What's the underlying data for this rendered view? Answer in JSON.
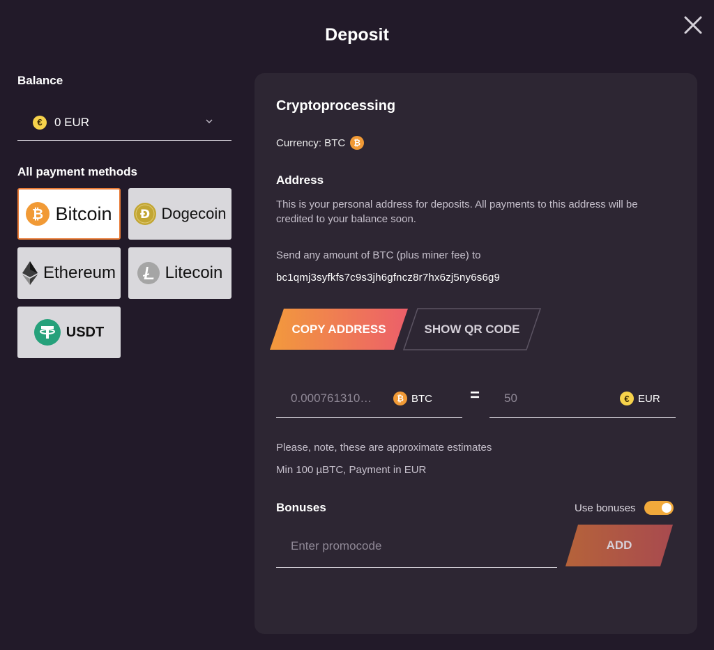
{
  "header": {
    "title": "Deposit"
  },
  "balance": {
    "label": "Balance",
    "currency_symbol": "€",
    "value": "0 EUR"
  },
  "methods": {
    "label": "All payment methods",
    "items": [
      {
        "label": "Bitcoin",
        "icon": "bitcoin-icon",
        "selected": true
      },
      {
        "label": "Dogecoin",
        "icon": "dogecoin-icon",
        "selected": false
      },
      {
        "label": "Ethereum",
        "icon": "ethereum-icon",
        "selected": false
      },
      {
        "label": "Litecoin",
        "icon": "litecoin-icon",
        "selected": false
      },
      {
        "label": "USDT",
        "icon": "tether-icon",
        "selected": false
      }
    ]
  },
  "panel": {
    "title": "Cryptoprocessing",
    "currency_label": "Currency: BTC",
    "address_title": "Address",
    "address_desc": "This is your personal address for deposits. All payments to this address will be credited to your balance soon.",
    "send_text": "Send any amount of BTC (plus miner fee) to",
    "address": "bc1qmj3syfkfs7c9s3jh6gfncz8r7hx6zj5ny6s6g9",
    "copy_label": "COPY ADDRESS",
    "qr_label": "SHOW QR CODE",
    "btc_amount": "0.000761310…",
    "btc_unit": "BTC",
    "equals": "=",
    "eur_amount": "50",
    "eur_unit": "EUR",
    "note1": "Please, note, these are approximate estimates",
    "note2": "Min 100 µBTC, Payment in EUR",
    "bonus_title": "Bonuses",
    "use_bonuses_label": "Use bonuses",
    "use_bonuses_on": true,
    "promo_placeholder": "Enter promocode",
    "add_label": "ADD"
  },
  "colors": {
    "background": "#221a29",
    "panel": "#2d2633",
    "accent_orange": "#f19a36",
    "accent_gradient_start": "#f29a3c",
    "accent_gradient_end": "#ec5f6a",
    "selected_border": "#e87a35"
  }
}
